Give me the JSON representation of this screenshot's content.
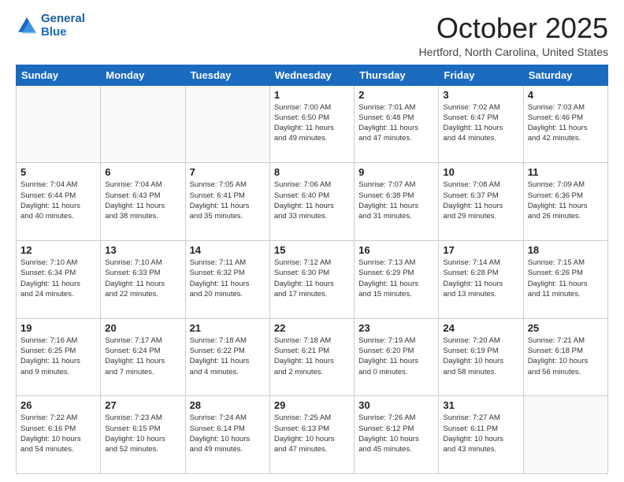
{
  "header": {
    "logo_line1": "General",
    "logo_line2": "Blue",
    "month": "October 2025",
    "location": "Hertford, North Carolina, United States"
  },
  "days_of_week": [
    "Sunday",
    "Monday",
    "Tuesday",
    "Wednesday",
    "Thursday",
    "Friday",
    "Saturday"
  ],
  "weeks": [
    [
      {
        "day": "",
        "info": ""
      },
      {
        "day": "",
        "info": ""
      },
      {
        "day": "",
        "info": ""
      },
      {
        "day": "1",
        "info": "Sunrise: 7:00 AM\nSunset: 6:50 PM\nDaylight: 11 hours\nand 49 minutes."
      },
      {
        "day": "2",
        "info": "Sunrise: 7:01 AM\nSunset: 6:48 PM\nDaylight: 11 hours\nand 47 minutes."
      },
      {
        "day": "3",
        "info": "Sunrise: 7:02 AM\nSunset: 6:47 PM\nDaylight: 11 hours\nand 44 minutes."
      },
      {
        "day": "4",
        "info": "Sunrise: 7:03 AM\nSunset: 6:46 PM\nDaylight: 11 hours\nand 42 minutes."
      }
    ],
    [
      {
        "day": "5",
        "info": "Sunrise: 7:04 AM\nSunset: 6:44 PM\nDaylight: 11 hours\nand 40 minutes."
      },
      {
        "day": "6",
        "info": "Sunrise: 7:04 AM\nSunset: 6:43 PM\nDaylight: 11 hours\nand 38 minutes."
      },
      {
        "day": "7",
        "info": "Sunrise: 7:05 AM\nSunset: 6:41 PM\nDaylight: 11 hours\nand 35 minutes."
      },
      {
        "day": "8",
        "info": "Sunrise: 7:06 AM\nSunset: 6:40 PM\nDaylight: 11 hours\nand 33 minutes."
      },
      {
        "day": "9",
        "info": "Sunrise: 7:07 AM\nSunset: 6:38 PM\nDaylight: 11 hours\nand 31 minutes."
      },
      {
        "day": "10",
        "info": "Sunrise: 7:08 AM\nSunset: 6:37 PM\nDaylight: 11 hours\nand 29 minutes."
      },
      {
        "day": "11",
        "info": "Sunrise: 7:09 AM\nSunset: 6:36 PM\nDaylight: 11 hours\nand 26 minutes."
      }
    ],
    [
      {
        "day": "12",
        "info": "Sunrise: 7:10 AM\nSunset: 6:34 PM\nDaylight: 11 hours\nand 24 minutes."
      },
      {
        "day": "13",
        "info": "Sunrise: 7:10 AM\nSunset: 6:33 PM\nDaylight: 11 hours\nand 22 minutes."
      },
      {
        "day": "14",
        "info": "Sunrise: 7:11 AM\nSunset: 6:32 PM\nDaylight: 11 hours\nand 20 minutes."
      },
      {
        "day": "15",
        "info": "Sunrise: 7:12 AM\nSunset: 6:30 PM\nDaylight: 11 hours\nand 17 minutes."
      },
      {
        "day": "16",
        "info": "Sunrise: 7:13 AM\nSunset: 6:29 PM\nDaylight: 11 hours\nand 15 minutes."
      },
      {
        "day": "17",
        "info": "Sunrise: 7:14 AM\nSunset: 6:28 PM\nDaylight: 11 hours\nand 13 minutes."
      },
      {
        "day": "18",
        "info": "Sunrise: 7:15 AM\nSunset: 6:26 PM\nDaylight: 11 hours\nand 11 minutes."
      }
    ],
    [
      {
        "day": "19",
        "info": "Sunrise: 7:16 AM\nSunset: 6:25 PM\nDaylight: 11 hours\nand 9 minutes."
      },
      {
        "day": "20",
        "info": "Sunrise: 7:17 AM\nSunset: 6:24 PM\nDaylight: 11 hours\nand 7 minutes."
      },
      {
        "day": "21",
        "info": "Sunrise: 7:18 AM\nSunset: 6:22 PM\nDaylight: 11 hours\nand 4 minutes."
      },
      {
        "day": "22",
        "info": "Sunrise: 7:18 AM\nSunset: 6:21 PM\nDaylight: 11 hours\nand 2 minutes."
      },
      {
        "day": "23",
        "info": "Sunrise: 7:19 AM\nSunset: 6:20 PM\nDaylight: 11 hours\nand 0 minutes."
      },
      {
        "day": "24",
        "info": "Sunrise: 7:20 AM\nSunset: 6:19 PM\nDaylight: 10 hours\nand 58 minutes."
      },
      {
        "day": "25",
        "info": "Sunrise: 7:21 AM\nSunset: 6:18 PM\nDaylight: 10 hours\nand 56 minutes."
      }
    ],
    [
      {
        "day": "26",
        "info": "Sunrise: 7:22 AM\nSunset: 6:16 PM\nDaylight: 10 hours\nand 54 minutes."
      },
      {
        "day": "27",
        "info": "Sunrise: 7:23 AM\nSunset: 6:15 PM\nDaylight: 10 hours\nand 52 minutes."
      },
      {
        "day": "28",
        "info": "Sunrise: 7:24 AM\nSunset: 6:14 PM\nDaylight: 10 hours\nand 49 minutes."
      },
      {
        "day": "29",
        "info": "Sunrise: 7:25 AM\nSunset: 6:13 PM\nDaylight: 10 hours\nand 47 minutes."
      },
      {
        "day": "30",
        "info": "Sunrise: 7:26 AM\nSunset: 6:12 PM\nDaylight: 10 hours\nand 45 minutes."
      },
      {
        "day": "31",
        "info": "Sunrise: 7:27 AM\nSunset: 6:11 PM\nDaylight: 10 hours\nand 43 minutes."
      },
      {
        "day": "",
        "info": ""
      }
    ]
  ]
}
